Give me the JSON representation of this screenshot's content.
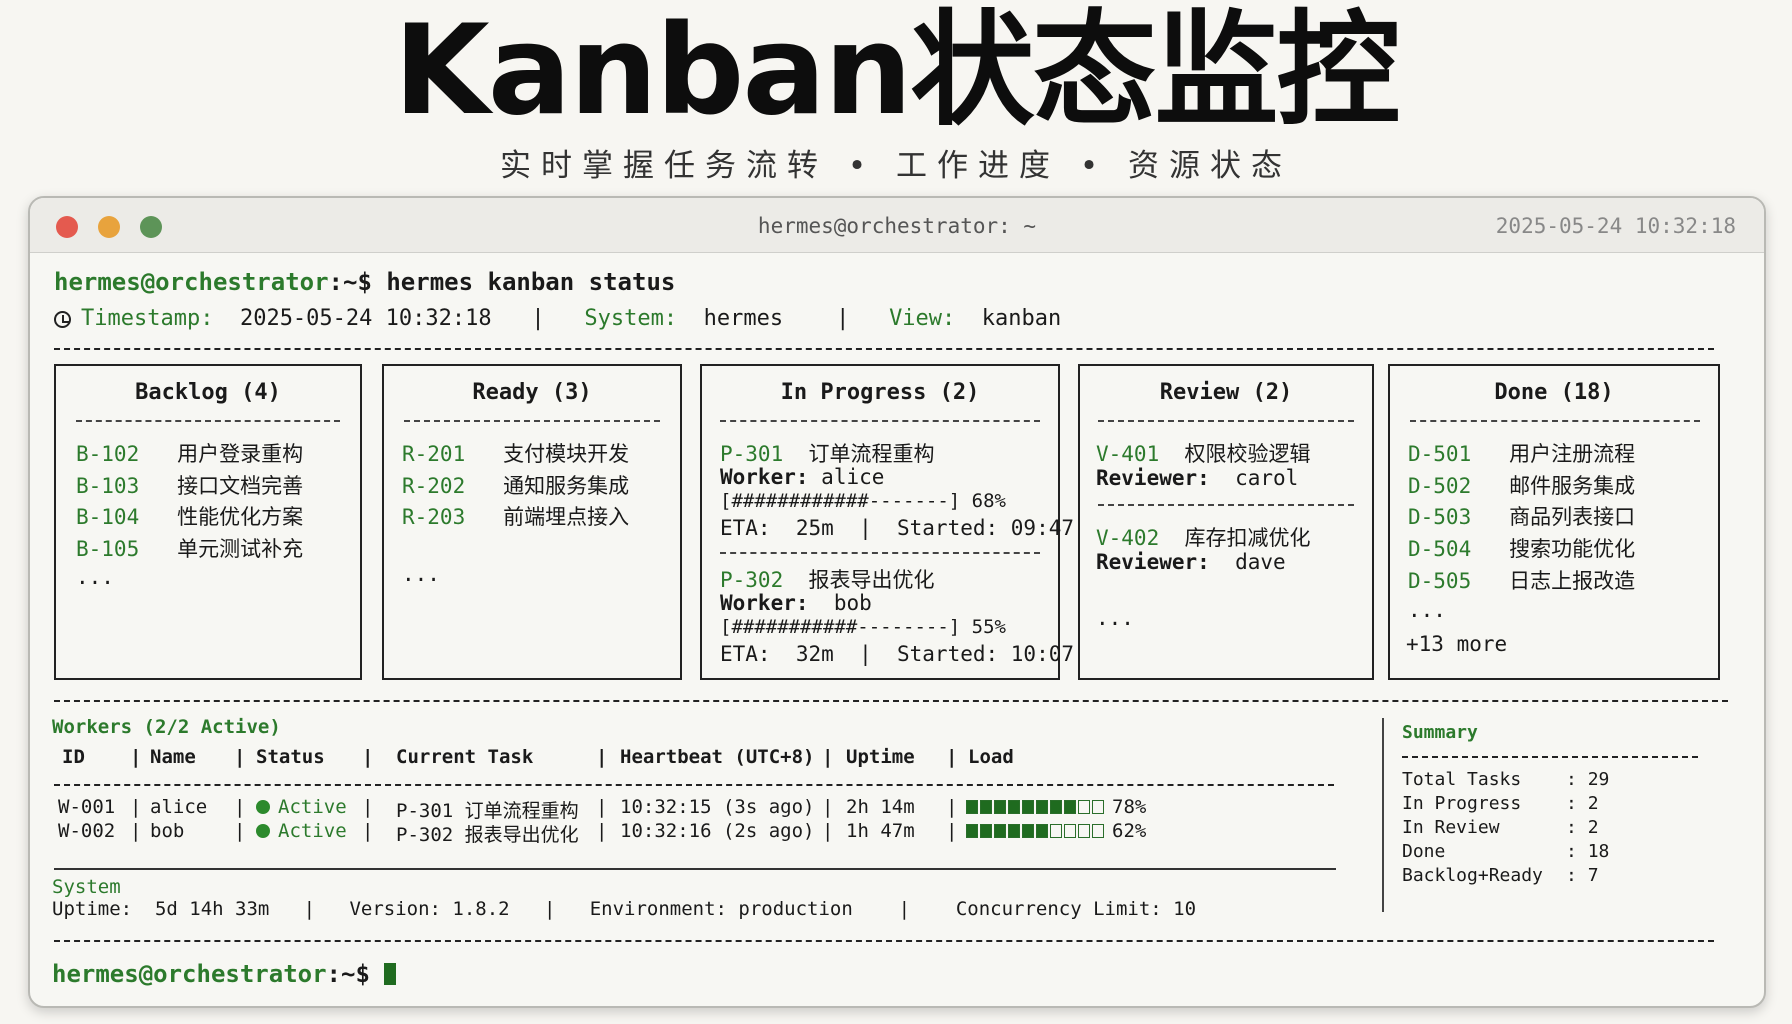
{
  "header": {
    "title": "Kanban状态监控",
    "subtitle": "实时掌握任务流转 • 工作进度 • 资源状态"
  },
  "window": {
    "title": "hermes@orchestrator: ~",
    "timestamp": "2025-05-24 10:32:18"
  },
  "terminal": {
    "prompt_user": "hermes@orchestrator",
    "prompt_path": ":~$",
    "command": "hermes kanban status",
    "info": {
      "timestamp_label": "Timestamp:",
      "timestamp_value": "2025-05-24 10:32:18",
      "system_label": "System:",
      "system_value": "hermes",
      "view_label": "View:",
      "view_value": "kanban",
      "sep": "|"
    }
  },
  "columns": {
    "backlog": {
      "title": "Backlog (4)",
      "items": [
        {
          "id": "B-102",
          "name": "用户登录重构"
        },
        {
          "id": "B-103",
          "name": "接口文档完善"
        },
        {
          "id": "B-104",
          "name": "性能优化方案"
        },
        {
          "id": "B-105",
          "name": "单元测试补充"
        }
      ],
      "more": "..."
    },
    "ready": {
      "title": "Ready (3)",
      "items": [
        {
          "id": "R-201",
          "name": "支付模块开发"
        },
        {
          "id": "R-202",
          "name": "通知服务集成"
        },
        {
          "id": "R-203",
          "name": "前端埋点接入"
        }
      ],
      "more": "..."
    },
    "in_progress": {
      "title": "In Progress (2)",
      "tasks": [
        {
          "id": "P-301",
          "name": "订单流程重构",
          "worker_label": "Worker:",
          "worker": "alice",
          "progress_bar": "[############-------]",
          "progress": 68,
          "progress_text": "68%",
          "eta_line": "ETA:  25m  |  Started: 09:47"
        },
        {
          "id": "P-302",
          "name": "报表导出优化",
          "worker_label": "Worker:",
          "worker": "bob",
          "progress_bar": "[###########--------]",
          "progress": 55,
          "progress_text": "55%",
          "eta_line": "ETA:  32m  |  Started: 10:07"
        }
      ]
    },
    "review": {
      "title": "Review (2)",
      "tasks": [
        {
          "id": "V-401",
          "name": "权限校验逻辑",
          "reviewer_label": "Reviewer:",
          "reviewer": "carol"
        },
        {
          "id": "V-402",
          "name": "库存扣减优化",
          "reviewer_label": "Reviewer:",
          "reviewer": "dave"
        }
      ],
      "more": "..."
    },
    "done": {
      "title": "Done (18)",
      "items": [
        {
          "id": "D-501",
          "name": "用户注册流程"
        },
        {
          "id": "D-502",
          "name": "邮件服务集成"
        },
        {
          "id": "D-503",
          "name": "商品列表接口"
        },
        {
          "id": "D-504",
          "name": "搜索功能优化"
        },
        {
          "id": "D-505",
          "name": "日志上报改造"
        }
      ],
      "more": "...",
      "extra": "+13 more"
    }
  },
  "workers": {
    "title": "Workers (2/2 Active)",
    "headers": [
      "ID",
      "Name",
      "Status",
      "Current Task",
      "Heartbeat (UTC+8)",
      "Uptime",
      "Load"
    ],
    "rows": [
      {
        "id": "W-001",
        "name": "alice",
        "status": "Active",
        "task": "P-301 订单流程重构",
        "heartbeat": "10:32:15 (3s ago)",
        "uptime": "2h 14m",
        "load": 78,
        "load_text": "78%"
      },
      {
        "id": "W-002",
        "name": "bob",
        "status": "Active",
        "task": "P-302 报表导出优化",
        "heartbeat": "10:32:16 (2s ago)",
        "uptime": "1h 47m",
        "load": 62,
        "load_text": "62%"
      }
    ],
    "sep": "|"
  },
  "system": {
    "title": "System",
    "uptime": "Uptime:  5d 14h 33m",
    "version": "Version: 1.8.2",
    "environment": "Environment: production",
    "concurrency": "Concurrency Limit: 10"
  },
  "summary": {
    "title": "Summary",
    "rows": [
      {
        "label": "Total Tasks",
        "value": "29"
      },
      {
        "label": "In Progress",
        "value": "2"
      },
      {
        "label": "In Review",
        "value": "2"
      },
      {
        "label": "Done",
        "value": "18"
      },
      {
        "label": "Backlog+Ready",
        "value": "7"
      }
    ]
  },
  "colors": {
    "accent_green": "#2c7a2c",
    "dot_red": "#e45a4f",
    "dot_yellow": "#e8a33d",
    "dot_green": "#5d9458"
  }
}
